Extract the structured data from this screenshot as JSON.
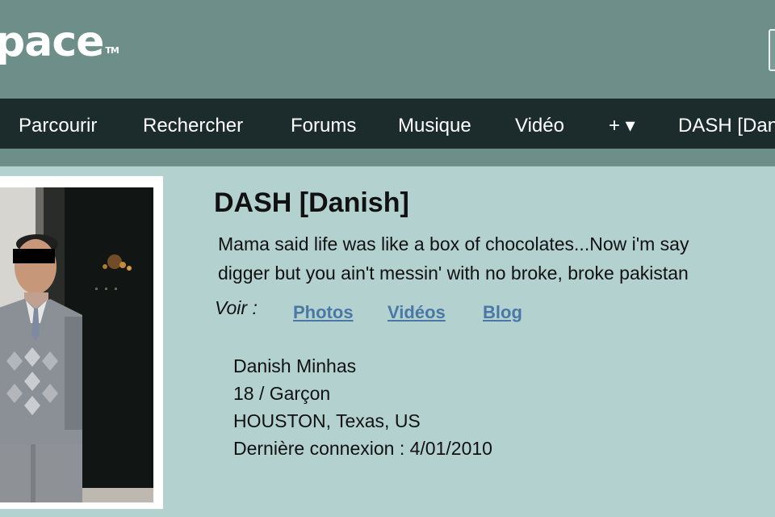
{
  "header": {
    "logo_text": "pace",
    "logo_mark": "TM"
  },
  "nav": {
    "items": [
      {
        "label": "Parcourir"
      },
      {
        "label": "Rechercher"
      },
      {
        "label": "Forums"
      },
      {
        "label": "Musique"
      },
      {
        "label": "Vidéo"
      },
      {
        "label": "+ ▾"
      },
      {
        "label": "DASH [Dan"
      }
    ]
  },
  "profile": {
    "name": "DASH [Danish]",
    "headline_line1": "Mama said life was like a box of chocolates...Now i'm say",
    "headline_line2": "digger but you ain't messin'  with  no broke, broke pakistan",
    "view_label": "Voir :",
    "links": [
      {
        "label": "Photos"
      },
      {
        "label": "Vidéos"
      },
      {
        "label": "Blog"
      }
    ],
    "info": {
      "full_name": "Danish Minhas",
      "age_gender": "18 / Garçon",
      "location": "HOUSTON, Texas, US",
      "last_login": "Dernière connexion : 4/01/2010"
    }
  },
  "colors": {
    "header_bg": "#6e8e89",
    "nav_bg": "#1c2b2b",
    "page_bg": "#b3d2cf",
    "link": "#4a78a6"
  }
}
